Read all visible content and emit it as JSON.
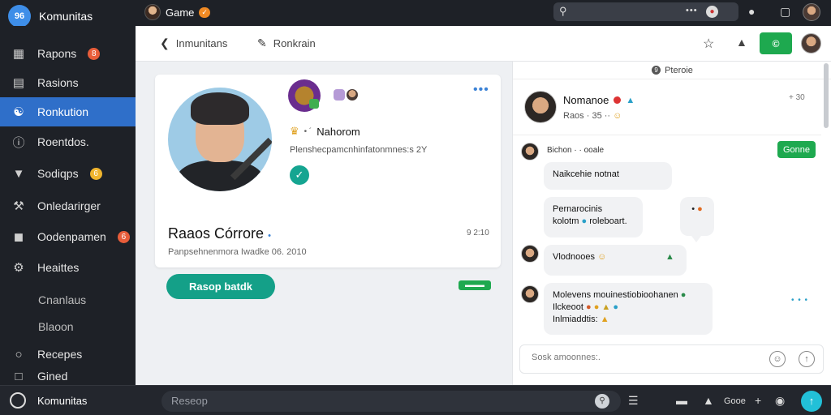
{
  "app": {
    "name": "Komunitas",
    "logo_text": "96"
  },
  "topbar": {
    "game_tab": "Game",
    "game_badge": "✓",
    "search": {
      "dots": "•••"
    }
  },
  "sidebar": {
    "items": [
      {
        "label": "Rapons",
        "icon": "layout-icon",
        "badge": "8"
      },
      {
        "label": "Rasions",
        "icon": "list-icon"
      },
      {
        "label": "Ronkution",
        "icon": "people-icon",
        "active": true
      },
      {
        "label": "Roentdos.",
        "icon": "info-icon"
      },
      {
        "label": "Sodiqps",
        "icon": "filter-icon",
        "badge": "6"
      },
      {
        "label": "Onledarirger",
        "icon": "wrench-icon"
      },
      {
        "label": "Oodenpamen",
        "icon": "square-icon",
        "badge": "6"
      },
      {
        "label": "Heaittes",
        "icon": "gear-icon"
      },
      {
        "label": "Cnanlaus"
      },
      {
        "label": "Blaoon"
      },
      {
        "label": "Recepes",
        "icon": "circle-icon"
      },
      {
        "label": "Gined",
        "icon": "box-icon"
      }
    ]
  },
  "toolbar": {
    "back_label": "Inmunitans",
    "edit_label": "Ronkrain",
    "green_button": "©"
  },
  "profile_card": {
    "name_row": "Nahorom",
    "name_row_mark": "• ´",
    "subtitle": "Plenshecpamcnhinfatonmnes:s 2Y",
    "title": "Raaos Córrore",
    "title_mark": "•",
    "number": "9 2:10",
    "meta": "Panpsehnenmora Iwadke 06. 2010",
    "primary_button": "Rasop batdk",
    "tag": "▬▬▬"
  },
  "chat": {
    "header": "Pteroie",
    "header_badge": "9",
    "user": {
      "name": "Nomanoe",
      "status": "Raos · 35 ··",
      "action": "+ 30"
    },
    "system_line": "Bichon · · ooale",
    "system_button": "Gonne",
    "messages": [
      {
        "text": "Naikcehie notnat"
      },
      {
        "line1": "Pernarocinis",
        "line2": "kolotm",
        "line2_tail": "roleboart."
      },
      {
        "react": "•"
      },
      {
        "text": "Vlodnooes"
      },
      {
        "line1": "Molevens mouinestiobioohanen",
        "line2": "Ilckeoot",
        "line3": "Inlmiaddtis:"
      }
    ],
    "input_placeholder": "Sosk amoonnes:.",
    "more_dots": "• • •"
  },
  "bottombar": {
    "brand": "Komunitas",
    "search_placeholder": "Reseop",
    "label": "Gooe"
  },
  "colors": {
    "accent": "#2f6fc9",
    "green": "#1ea94f",
    "teal": "#14a088",
    "sidebar_bg": "#1e2127"
  }
}
